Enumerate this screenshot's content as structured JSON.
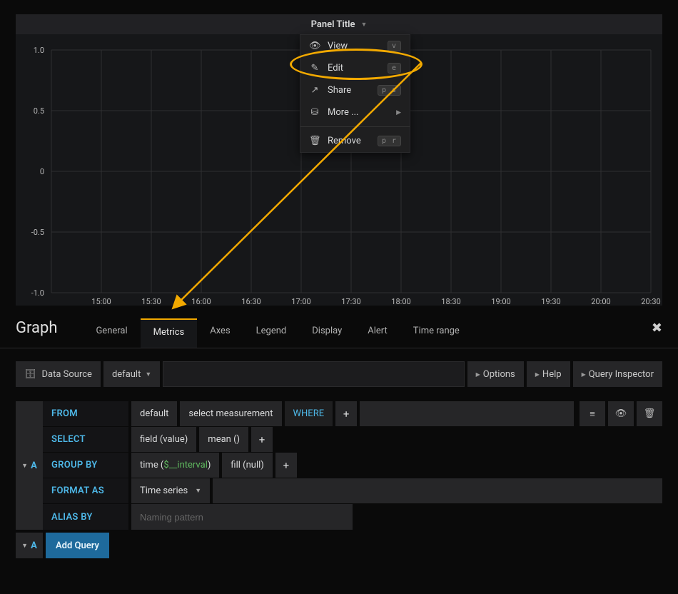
{
  "panel": {
    "title": "Panel Title"
  },
  "dropdown": {
    "view": "View",
    "view_kbd": "v",
    "edit": "Edit",
    "edit_kbd": "e",
    "share": "Share",
    "share_kbd": "p s",
    "more": "More ...",
    "remove": "Remove",
    "remove_kbd": "p r"
  },
  "chart_data": {
    "type": "line",
    "x_ticks": [
      "15:00",
      "15:30",
      "16:00",
      "16:30",
      "17:00",
      "17:30",
      "18:00",
      "18:30",
      "19:00",
      "19:30",
      "20:00",
      "20:30"
    ],
    "y_ticks": [
      "-1.0",
      "-0.5",
      "0",
      "0.5",
      "1.0"
    ],
    "ylim": [
      -1.0,
      1.0
    ],
    "series": []
  },
  "tabs": {
    "section": "Graph",
    "general": "General",
    "metrics": "Metrics",
    "axes": "Axes",
    "legend": "Legend",
    "display": "Display",
    "alert": "Alert",
    "timerange": "Time range",
    "active": "metrics"
  },
  "toolbar": {
    "datasource_label": "Data Source",
    "datasource_value": "default",
    "options": "Options",
    "help": "Help",
    "inspector": "Query Inspector"
  },
  "query": {
    "letter": "A",
    "from": {
      "key": "FROM",
      "source": "default",
      "measurement": "select measurement",
      "where": "WHERE"
    },
    "select": {
      "key": "SELECT",
      "field": "field (value)",
      "agg": "mean ()"
    },
    "groupby": {
      "key": "GROUP BY",
      "time_prefix": "time (",
      "time_var": "$__interval",
      "time_suffix": ")",
      "fill": "fill (null)"
    },
    "format": {
      "key": "FORMAT AS",
      "value": "Time series"
    },
    "alias": {
      "key": "ALIAS BY",
      "placeholder": "Naming pattern"
    }
  },
  "addquery": {
    "letter": "A",
    "label": "Add Query"
  }
}
